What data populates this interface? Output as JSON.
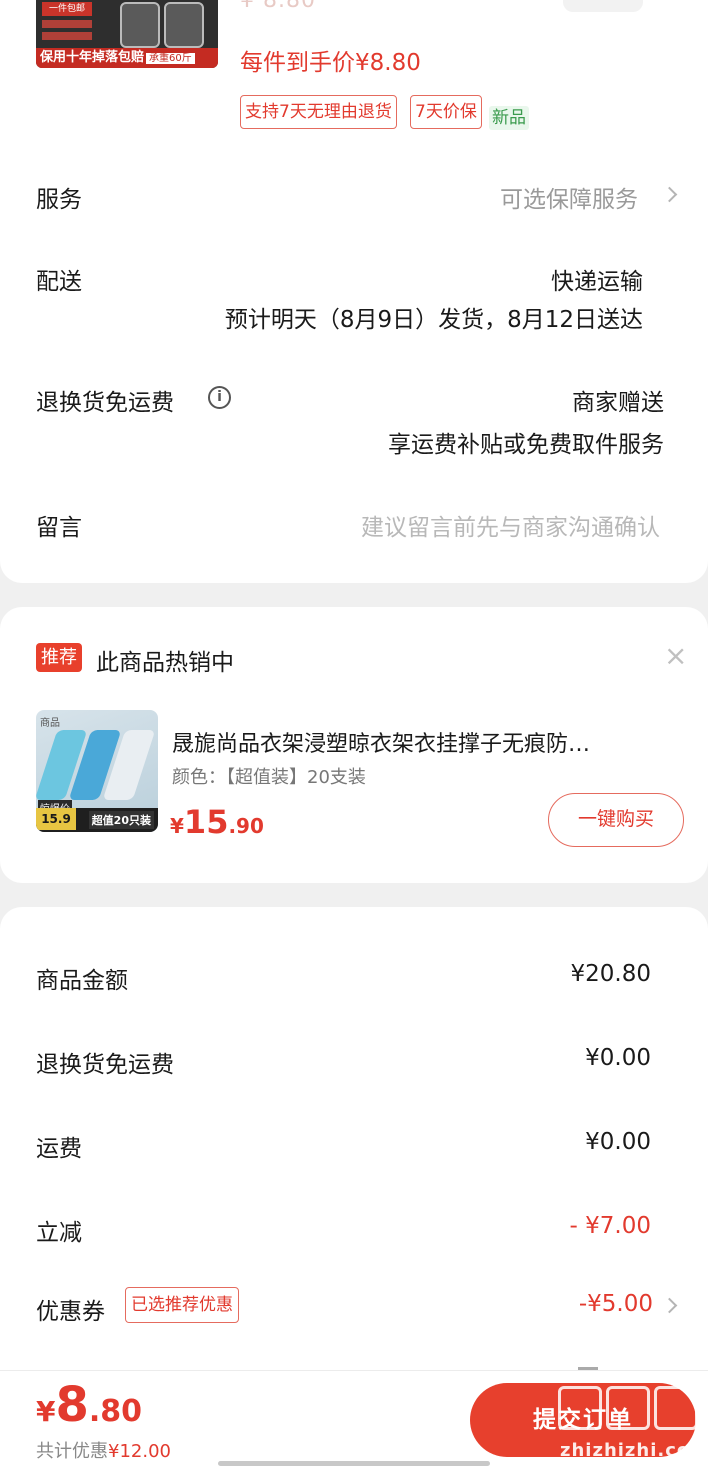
{
  "product": {
    "each_price": "每件到手价¥8.80",
    "thumb_top_banner": "保用十年掉落包赔",
    "thumb_top_banner_tag": "承重60斤",
    "thumb_top_tag": "一件包邮",
    "badges": [
      "支持7天无理由退货",
      "7天价保"
    ],
    "badge_new": "新品"
  },
  "rows": {
    "service_label": "服务",
    "service_value": "可选保障服务",
    "delivery_label": "配送",
    "delivery_value": "快递运输",
    "delivery_detail": "预计明天（8月9日）发货，8月12日送达",
    "return_label": "退换货免运费",
    "return_value": "商家赠送",
    "return_detail": "享运费补贴或免费取件服务",
    "message_label": "留言",
    "message_placeholder": "建议留言前先与商家沟通确认"
  },
  "recommend": {
    "tag": "推荐",
    "title": "此商品热销中",
    "name": "晟旎尚品衣架浸塑晾衣架衣挂撑子无痕防…",
    "color": "颜色：【超值装】20支装",
    "price_yen": "¥",
    "price_int": "15",
    "price_dec": ".90",
    "buy_label": "一键购买",
    "img_badge": "超值20只装",
    "img_price": "15.9",
    "img_seal": "惊爆价",
    "img_top_label": "商品"
  },
  "summary": {
    "items": [
      {
        "label": "商品金额",
        "value": "¥20.80"
      },
      {
        "label": "退换货免运费",
        "value": "¥0.00"
      },
      {
        "label": "运费",
        "value": "¥0.00"
      },
      {
        "label": "立减",
        "value": "- ¥7.00"
      },
      {
        "label": "优惠券",
        "value": "-¥5.00"
      }
    ],
    "coupon_tag": "已选推荐优惠"
  },
  "bottom": {
    "yen": "¥",
    "int": "8",
    "dec": ".80",
    "discount_prefix": "共计优惠",
    "discount_value": "¥12.00",
    "submit_label": "提交订单"
  },
  "watermark": "zhizhizhi.com",
  "colors": {
    "accent_red": "#e23a2e",
    "button_red": "#e7402d",
    "muted_gray": "#9a9a9a",
    "new_green": "#3a9b4d"
  }
}
